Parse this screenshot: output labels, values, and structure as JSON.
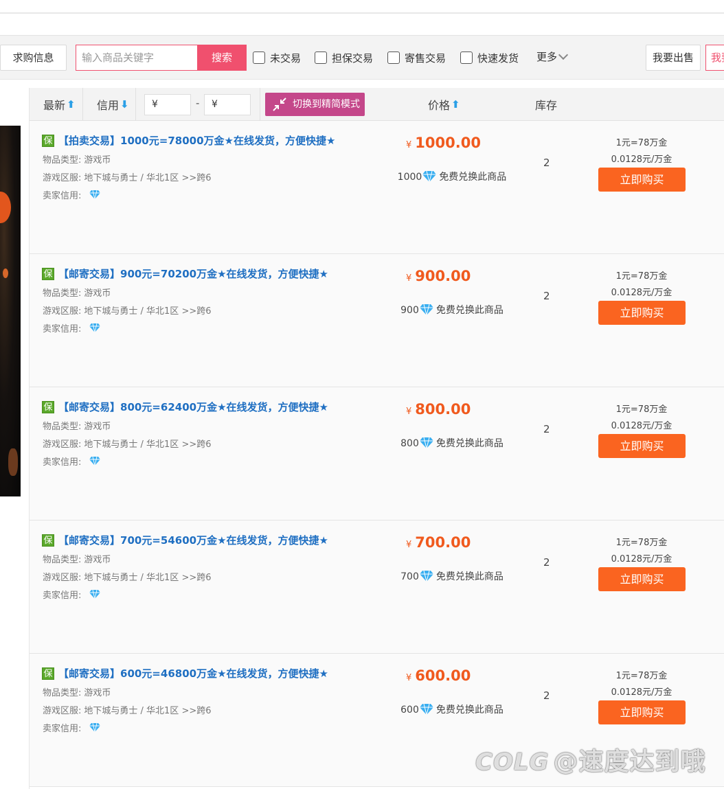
{
  "toolbar": {
    "buy_info": "求购信息",
    "search_placeholder": "输入商品关键字",
    "search_button": "搜索",
    "filters": [
      "未交易",
      "担保交易",
      "寄售交易",
      "快速发货"
    ],
    "more": "更多",
    "sell_button": "我要出售",
    "sell_button_2": "我要"
  },
  "list_header": {
    "newest": "最新",
    "credit": "信用",
    "price_min": "¥",
    "price_max": "¥",
    "dash": "-",
    "switch_mode": "切换到精简模式",
    "price": "价格",
    "stock": "库存"
  },
  "labels": {
    "item_type": "物品类型:",
    "server": "游戏区服:",
    "seller_credit": "卖家信用:",
    "guarantee_badge": "保",
    "redeem_text": "免费兑换此商品",
    "buy_now": "立即购买",
    "yen": "¥"
  },
  "items": [
    {
      "title": "【拍卖交易】1000元=78000万金★在线发货，方便快捷★",
      "item_type": "游戏币",
      "server": "地下城与勇士 / 华北1区 >>跨6",
      "price": "1000.00",
      "redeem_points": "1000",
      "stock": "2",
      "rate1": "1元=78万金",
      "rate2": "0.0128元/万金"
    },
    {
      "title": "【邮寄交易】900元=70200万金★在线发货，方便快捷★",
      "item_type": "游戏币",
      "server": "地下城与勇士 / 华北1区 >>跨6",
      "price": "900.00",
      "redeem_points": "900",
      "stock": "2",
      "rate1": "1元=78万金",
      "rate2": "0.0128元/万金"
    },
    {
      "title": "【邮寄交易】800元=62400万金★在线发货，方便快捷★",
      "item_type": "游戏币",
      "server": "地下城与勇士 / 华北1区 >>跨6",
      "price": "800.00",
      "redeem_points": "800",
      "stock": "2",
      "rate1": "1元=78万金",
      "rate2": "0.0128元/万金"
    },
    {
      "title": "【邮寄交易】700元=54600万金★在线发货，方便快捷★",
      "item_type": "游戏币",
      "server": "地下城与勇士 / 华北1区 >>跨6",
      "price": "700.00",
      "redeem_points": "700",
      "stock": "2",
      "rate1": "1元=78万金",
      "rate2": "0.0128元/万金"
    },
    {
      "title": "【邮寄交易】600元=46800万金★在线发货，方便快捷★",
      "item_type": "游戏币",
      "server": "地下城与勇士 / 华北1区 >>跨6",
      "price": "600.00",
      "redeem_points": "600",
      "stock": "2",
      "rate1": "1元=78万金",
      "rate2": "0.0128元/万金"
    }
  ],
  "watermark": {
    "logo": "COLG",
    "text": "@速度达到哦"
  },
  "colors": {
    "accent_pink": "#f0506e",
    "switch_purple": "#c4478a",
    "buy_orange": "#fa6420",
    "price_orange": "#f05a1e",
    "title_blue": "#1f6fc2",
    "guarantee_green": "#5aa82a",
    "sort_arrow_blue": "#2a9fe6"
  },
  "icons": [
    "diamond-icon",
    "shrink-icon",
    "checkbox",
    "chevron-down-icon",
    "arrow-up-icon",
    "arrow-down-icon"
  ]
}
